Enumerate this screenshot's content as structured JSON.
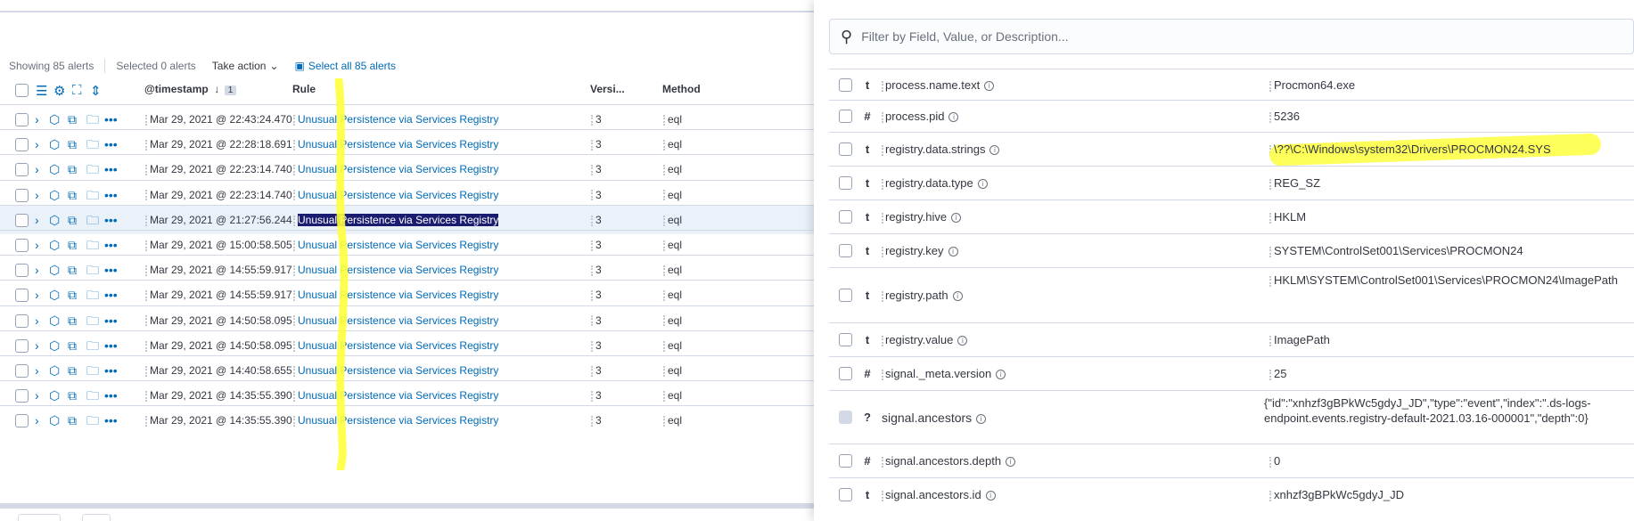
{
  "utility": {
    "showing": "Showing 85 alerts",
    "selected": "Selected 0 alerts",
    "take_action": "Take action",
    "select_all": "Select all 85 alerts"
  },
  "table": {
    "header": {
      "timestamp": "@timestamp",
      "sort_count": "1",
      "rule": "Rule",
      "version": "Versi...",
      "method": "Method"
    },
    "rows": [
      {
        "timestamp": "Mar 29, 2021 @ 22:43:24.470",
        "rule": "Unusual Persistence via Services Registry",
        "version": "3",
        "method": "eql"
      },
      {
        "timestamp": "Mar 29, 2021 @ 22:28:18.691",
        "rule": "Unusual Persistence via Services Registry",
        "version": "3",
        "method": "eql"
      },
      {
        "timestamp": "Mar 29, 2021 @ 22:23:14.740",
        "rule": "Unusual Persistence via Services Registry",
        "version": "3",
        "method": "eql"
      },
      {
        "timestamp": "Mar 29, 2021 @ 22:23:14.740",
        "rule": "Unusual Persistence via Services Registry",
        "version": "3",
        "method": "eql"
      },
      {
        "timestamp": "Mar 29, 2021 @ 21:27:56.244",
        "rule": "Unusual Persistence via Services Registry",
        "version": "3",
        "method": "eql"
      },
      {
        "timestamp": "Mar 29, 2021 @ 15:00:58.505",
        "rule": "Unusual Persistence via Services Registry",
        "version": "3",
        "method": "eql"
      },
      {
        "timestamp": "Mar 29, 2021 @ 14:55:59.917",
        "rule": "Unusual Persistence via Services Registry",
        "version": "3",
        "method": "eql"
      },
      {
        "timestamp": "Mar 29, 2021 @ 14:55:59.917",
        "rule": "Unusual Persistence via Services Registry",
        "version": "3",
        "method": "eql"
      },
      {
        "timestamp": "Mar 29, 2021 @ 14:50:58.095",
        "rule": "Unusual Persistence via Services Registry",
        "version": "3",
        "method": "eql"
      },
      {
        "timestamp": "Mar 29, 2021 @ 14:50:58.095",
        "rule": "Unusual Persistence via Services Registry",
        "version": "3",
        "method": "eql"
      },
      {
        "timestamp": "Mar 29, 2021 @ 14:40:58.655",
        "rule": "Unusual Persistence via Services Registry",
        "version": "3",
        "method": "eql"
      },
      {
        "timestamp": "Mar 29, 2021 @ 14:35:55.390",
        "rule": "Unusual Persistence via Services Registry",
        "version": "3",
        "method": "eql"
      },
      {
        "timestamp": "Mar 29, 2021 @ 14:35:55.390",
        "rule": "Unusual Persistence via Services Registry",
        "version": "3",
        "method": "eql"
      }
    ],
    "active_row": 4
  },
  "flyout": {
    "search_placeholder": "Filter by Field, Value, or Description...",
    "fields": [
      {
        "type": "t",
        "name": "process.name.text",
        "value": "Procmon64.exe"
      },
      {
        "type": "#",
        "name": "process.pid",
        "value": "5236"
      },
      {
        "type": "t",
        "name": "registry.data.strings",
        "value": "\\??\\C:\\Windows\\system32\\Drivers\\PROCMON24.SYS"
      },
      {
        "type": "t",
        "name": "registry.data.type",
        "value": "REG_SZ"
      },
      {
        "type": "t",
        "name": "registry.hive",
        "value": "HKLM"
      },
      {
        "type": "t",
        "name": "registry.key",
        "value": "SYSTEM\\ControlSet001\\Services\\PROCMON24"
      },
      {
        "type": "t",
        "name": "registry.path",
        "value": "HKLM\\SYSTEM\\ControlSet001\\Services\\PROCMON24\\ImagePath"
      },
      {
        "type": "t",
        "name": "registry.value",
        "value": "ImagePath"
      },
      {
        "type": "#",
        "name": "signal._meta.version",
        "value": "25"
      },
      {
        "type": "?",
        "name": "signal.ancestors",
        "value": "{\"id\":\"xnhzf3gBPkWc5gdyJ_JD\",\"type\":\"event\",\"index\":\".ds-logs-endpoint.events.registry-default-2021.03.16-000001\",\"depth\":0}"
      },
      {
        "type": "#",
        "name": "signal.ancestors.depth",
        "value": "0"
      },
      {
        "type": "t",
        "name": "signal.ancestors.id",
        "value": "xnhzf3gBPkWc5gdyJ_JD"
      }
    ]
  },
  "colors": {
    "link": "#006bb8",
    "highlight_marker": "#ffff3d",
    "selected_text_bg": "#1a1c70",
    "active_row_bg": "#ebf1f9",
    "border": "#d3dae6"
  },
  "icons": {
    "row_actions": [
      "checkbox",
      "expand-chevron-icon",
      "analyze-cube-icon",
      "process-tree-icon",
      "folder-icon",
      "more-actions-icon"
    ],
    "header": [
      "list-icon",
      "gear-icon",
      "fullscreen-icon",
      "sort-fields-icon"
    ]
  }
}
